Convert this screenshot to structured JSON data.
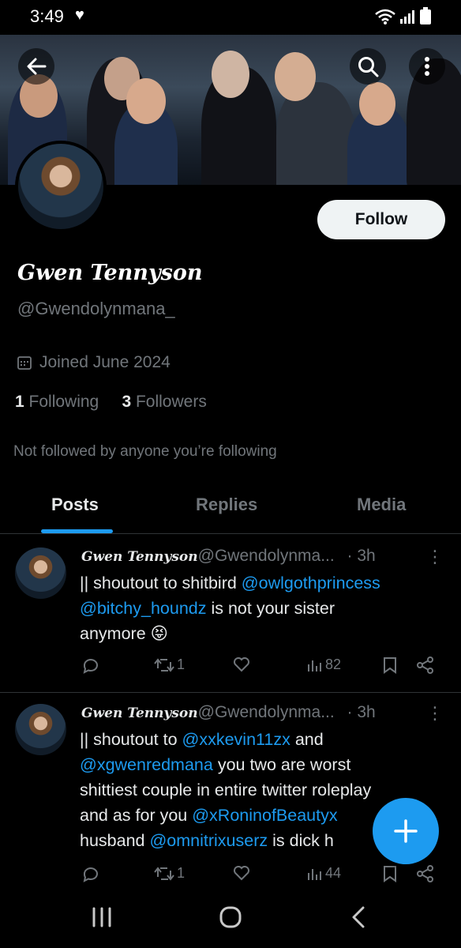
{
  "status_bar": {
    "time": "3:49"
  },
  "profile": {
    "display_name": "Gwen Tennyson",
    "handle": "@Gwendolynmana_",
    "joined": "Joined June 2024",
    "following_count": "1",
    "following_label": "Following",
    "followers_count": "3",
    "followers_label": "Followers",
    "not_followed": "Not followed by anyone you’re following",
    "follow_label": "Follow"
  },
  "tabs": [
    {
      "label": "Posts",
      "active": true
    },
    {
      "label": "Replies",
      "active": false
    },
    {
      "label": "Media",
      "active": false
    }
  ],
  "posts": [
    {
      "name": "Gwen Tennyson",
      "handle": "@Gwendolynma...",
      "time": "· 3h",
      "text_1": "|| shoutout to shitbird ",
      "mention_1": "@owlgothprincess",
      "mention_2": "@bitchy_houndz",
      "text_2": " is not your sister",
      "text_3": "anymore 😝",
      "retweets": "1",
      "views": "82"
    },
    {
      "name": "Gwen Tennyson",
      "handle": "@Gwendolynma...",
      "time": "· 3h",
      "text_1": "|| shoutout to ",
      "mention_1": "@xxkevin11zx",
      "text_2": " and",
      "mention_2": "@xgwenredmana",
      "text_3": " you two are worst",
      "text_4": "shittiest couple in entire twitter roleplay",
      "text_5": "and as for you ",
      "mention_3": "@xRoninofBeautyx",
      "text_6": "husband ",
      "mention_4": "@omnitrixuserz",
      "text_7": " is dick h",
      "retweets": "1",
      "views": "44"
    }
  ],
  "colors": {
    "accent": "#1d9bf0",
    "muted": "#71767b",
    "background": "#000000"
  }
}
